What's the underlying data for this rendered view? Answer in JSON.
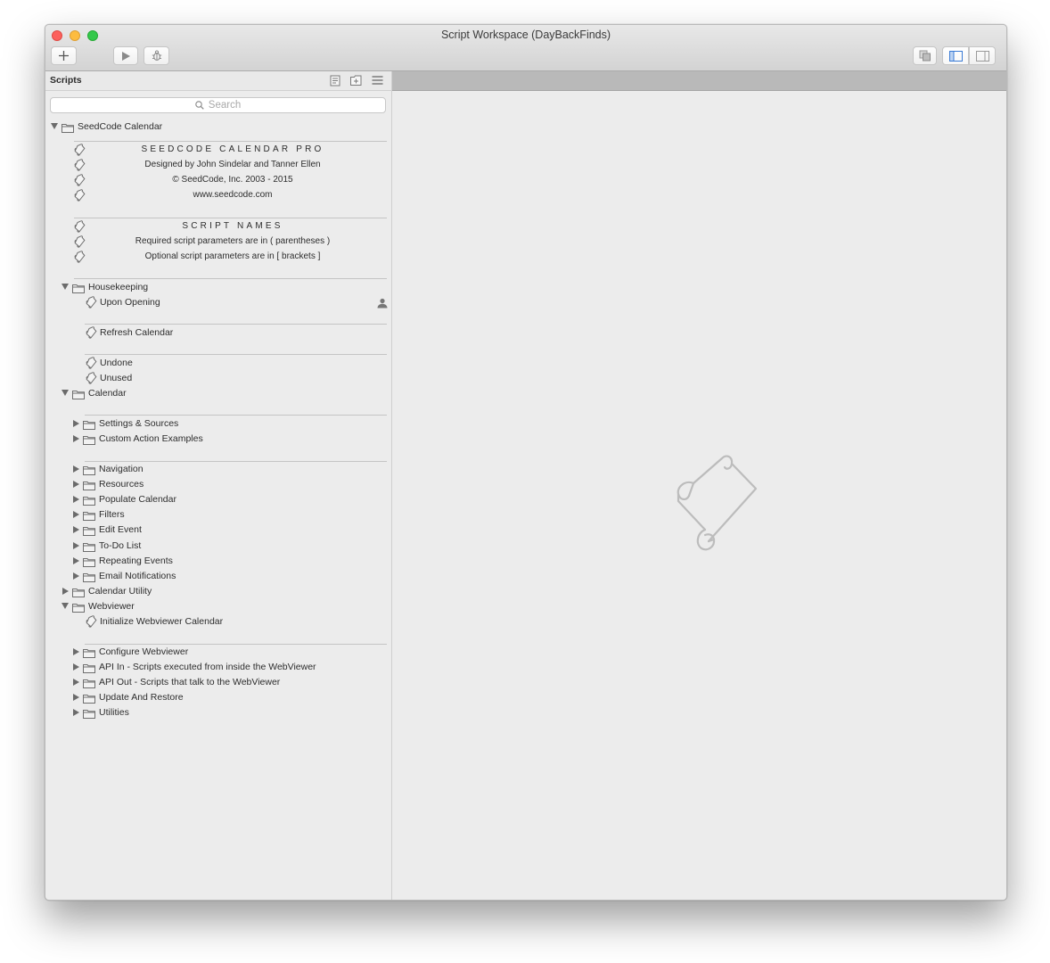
{
  "window": {
    "title": "Script Workspace (DayBackFinds)"
  },
  "sidebar": {
    "title": "Scripts",
    "search_placeholder": "Search"
  },
  "tree": {
    "root_folder": "SeedCode Calendar",
    "header_lines": [
      "SEEDCODE CALENDAR PRO",
      "Designed by John Sindelar and Tanner Ellen",
      "© SeedCode, Inc. 2003 - 2015",
      "www.seedcode.com"
    ],
    "names_lines": [
      "SCRIPT NAMES",
      "Required script parameters are in ( parentheses )",
      "Optional script parameters are in [ brackets ]"
    ],
    "housekeeping": {
      "label": "Housekeeping",
      "scripts": [
        "Upon Opening",
        "Refresh Calendar",
        "Undone",
        "Unused"
      ]
    },
    "calendar": {
      "label": "Calendar",
      "folders_a": [
        "Settings & Sources",
        "Custom Action Examples"
      ],
      "folders_b": [
        "Navigation",
        "Resources",
        "Populate Calendar",
        "Filters",
        "Edit Event",
        "To-Do List",
        "Repeating Events",
        "Email Notifications"
      ]
    },
    "calendar_utility": {
      "label": "Calendar Utility"
    },
    "webviewer": {
      "label": "Webviewer",
      "script": "Initialize Webviewer Calendar",
      "folders": [
        "Configure Webviewer",
        "API In - Scripts executed from inside the WebViewer",
        "API Out - Scripts that talk to the WebViewer",
        "Update And Restore",
        "Utilities"
      ]
    }
  }
}
